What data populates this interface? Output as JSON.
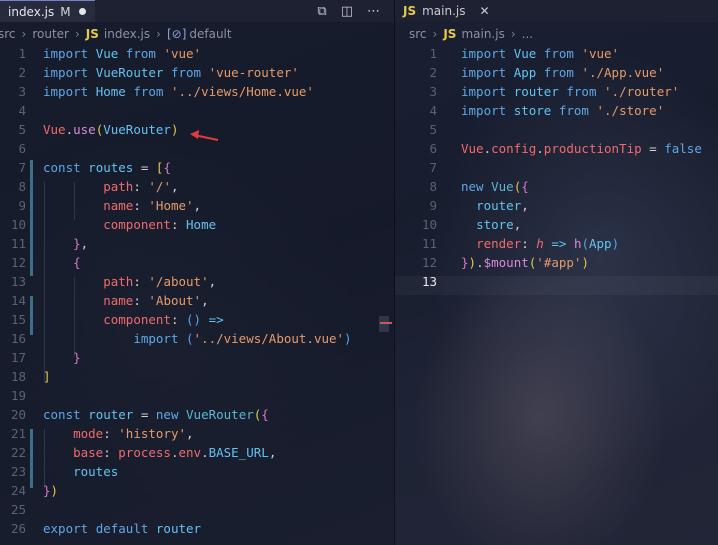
{
  "left": {
    "tab": {
      "label": "index.js",
      "modified": "M"
    },
    "breadcrumb": [
      "src",
      "router",
      "index.js",
      "default"
    ],
    "actions": [
      "compare-icon",
      "split-editor-icon",
      "more-icon"
    ],
    "lines": [
      {
        "n": "1",
        "tokens": [
          [
            "kw",
            "import"
          ],
          [
            "op",
            " "
          ],
          [
            "id",
            "Vue"
          ],
          [
            "op",
            " "
          ],
          [
            "kw",
            "from"
          ],
          [
            "op",
            " "
          ],
          [
            "str",
            "'vue'"
          ]
        ]
      },
      {
        "n": "2",
        "tokens": [
          [
            "kw",
            "import"
          ],
          [
            "op",
            " "
          ],
          [
            "id",
            "VueRouter"
          ],
          [
            "op",
            " "
          ],
          [
            "kw",
            "from"
          ],
          [
            "op",
            " "
          ],
          [
            "str",
            "'vue-router'"
          ]
        ]
      },
      {
        "n": "3",
        "tokens": [
          [
            "kw",
            "import"
          ],
          [
            "op",
            " "
          ],
          [
            "id",
            "Home"
          ],
          [
            "op",
            " "
          ],
          [
            "kw",
            "from"
          ],
          [
            "op",
            " "
          ],
          [
            "str",
            "'../views/Home.vue'"
          ]
        ]
      },
      {
        "n": "4",
        "tokens": []
      },
      {
        "n": "5",
        "tokens": [
          [
            "prop",
            "Vue"
          ],
          [
            "op",
            "."
          ],
          [
            "func",
            "use"
          ],
          [
            "br1",
            "("
          ],
          [
            "id",
            "VueRouter"
          ],
          [
            "br1",
            ")"
          ]
        ]
      },
      {
        "n": "6",
        "tokens": []
      },
      {
        "n": "7",
        "tokens": [
          [
            "kw",
            "const"
          ],
          [
            "op",
            " "
          ],
          [
            "id",
            "routes"
          ],
          [
            "op",
            " = "
          ],
          [
            "br1",
            "["
          ],
          [
            "br2",
            "{"
          ]
        ]
      },
      {
        "n": "8",
        "tokens": [
          [
            "op",
            "        "
          ],
          [
            "prop",
            "path"
          ],
          [
            "op",
            ": "
          ],
          [
            "str",
            "'/'"
          ],
          [
            "op",
            ","
          ]
        ]
      },
      {
        "n": "9",
        "tokens": [
          [
            "op",
            "        "
          ],
          [
            "prop",
            "name"
          ],
          [
            "op",
            ": "
          ],
          [
            "str",
            "'Home'"
          ],
          [
            "op",
            ","
          ]
        ]
      },
      {
        "n": "10",
        "tokens": [
          [
            "op",
            "        "
          ],
          [
            "prop",
            "component"
          ],
          [
            "op",
            ": "
          ],
          [
            "id",
            "Home"
          ]
        ]
      },
      {
        "n": "11",
        "tokens": [
          [
            "op",
            "    "
          ],
          [
            "br2",
            "}"
          ],
          [
            "op",
            ","
          ]
        ]
      },
      {
        "n": "12",
        "tokens": [
          [
            "op",
            "    "
          ],
          [
            "br2",
            "{"
          ]
        ]
      },
      {
        "n": "13",
        "tokens": [
          [
            "op",
            "        "
          ],
          [
            "prop",
            "path"
          ],
          [
            "op",
            ": "
          ],
          [
            "str",
            "'/about'"
          ],
          [
            "op",
            ","
          ]
        ]
      },
      {
        "n": "14",
        "tokens": [
          [
            "op",
            "        "
          ],
          [
            "prop",
            "name"
          ],
          [
            "op",
            ": "
          ],
          [
            "str",
            "'About'"
          ],
          [
            "op",
            ","
          ]
        ]
      },
      {
        "n": "15",
        "tokens": [
          [
            "op",
            "        "
          ],
          [
            "prop",
            "component"
          ],
          [
            "op",
            ": "
          ],
          [
            "br3",
            "()"
          ],
          [
            "op",
            " "
          ],
          [
            "arrowfn",
            "=>"
          ]
        ]
      },
      {
        "n": "16",
        "tokens": [
          [
            "op",
            "            "
          ],
          [
            "kw",
            "import"
          ],
          [
            "op",
            " "
          ],
          [
            "br3",
            "("
          ],
          [
            "str",
            "'../views/About.vue'"
          ],
          [
            "br3",
            ")"
          ]
        ]
      },
      {
        "n": "17",
        "tokens": [
          [
            "op",
            "    "
          ],
          [
            "br2",
            "}"
          ]
        ]
      },
      {
        "n": "18",
        "tokens": [
          [
            "br1",
            "]"
          ]
        ]
      },
      {
        "n": "19",
        "tokens": []
      },
      {
        "n": "20",
        "tokens": [
          [
            "kw",
            "const"
          ],
          [
            "op",
            " "
          ],
          [
            "id",
            "router"
          ],
          [
            "op",
            " = "
          ],
          [
            "kw",
            "new"
          ],
          [
            "op",
            " "
          ],
          [
            "cls",
            "VueRouter"
          ],
          [
            "br1",
            "("
          ],
          [
            "br2",
            "{"
          ]
        ]
      },
      {
        "n": "21",
        "tokens": [
          [
            "op",
            "    "
          ],
          [
            "prop",
            "mode"
          ],
          [
            "op",
            ": "
          ],
          [
            "str",
            "'history'"
          ],
          [
            "op",
            ","
          ]
        ]
      },
      {
        "n": "22",
        "tokens": [
          [
            "op",
            "    "
          ],
          [
            "prop",
            "base"
          ],
          [
            "op",
            ": "
          ],
          [
            "prop",
            "process"
          ],
          [
            "op",
            "."
          ],
          [
            "prop",
            "env"
          ],
          [
            "op",
            "."
          ],
          [
            "id",
            "BASE_URL"
          ],
          [
            "op",
            ","
          ]
        ]
      },
      {
        "n": "23",
        "tokens": [
          [
            "op",
            "    "
          ],
          [
            "id",
            "routes"
          ]
        ]
      },
      {
        "n": "24",
        "tokens": [
          [
            "br2",
            "}"
          ],
          [
            "br1",
            ")"
          ]
        ]
      },
      {
        "n": "25",
        "tokens": []
      },
      {
        "n": "26",
        "tokens": [
          [
            "kw",
            "export"
          ],
          [
            "op",
            " "
          ],
          [
            "kw",
            "default"
          ],
          [
            "op",
            " "
          ],
          [
            "id",
            "router"
          ]
        ]
      }
    ]
  },
  "right": {
    "tab": {
      "label": "main.js",
      "close": "✕"
    },
    "breadcrumb": [
      "src",
      "main.js",
      "..."
    ],
    "current_line": "13",
    "lines": [
      {
        "n": "1",
        "tokens": [
          [
            "kw",
            "import"
          ],
          [
            "op",
            " "
          ],
          [
            "id",
            "Vue"
          ],
          [
            "op",
            " "
          ],
          [
            "kw",
            "from"
          ],
          [
            "op",
            " "
          ],
          [
            "str",
            "'vue'"
          ]
        ]
      },
      {
        "n": "2",
        "tokens": [
          [
            "kw",
            "import"
          ],
          [
            "op",
            " "
          ],
          [
            "id",
            "App"
          ],
          [
            "op",
            " "
          ],
          [
            "kw",
            "from"
          ],
          [
            "op",
            " "
          ],
          [
            "str",
            "'./App.vue'"
          ]
        ]
      },
      {
        "n": "3",
        "tokens": [
          [
            "kw",
            "import"
          ],
          [
            "op",
            " "
          ],
          [
            "id",
            "router"
          ],
          [
            "op",
            " "
          ],
          [
            "kw",
            "from"
          ],
          [
            "op",
            " "
          ],
          [
            "str",
            "'./router'"
          ]
        ]
      },
      {
        "n": "4",
        "tokens": [
          [
            "kw",
            "import"
          ],
          [
            "op",
            " "
          ],
          [
            "id",
            "store"
          ],
          [
            "op",
            " "
          ],
          [
            "kw",
            "from"
          ],
          [
            "op",
            " "
          ],
          [
            "str",
            "'./store'"
          ]
        ]
      },
      {
        "n": "5",
        "tokens": []
      },
      {
        "n": "6",
        "tokens": [
          [
            "prop",
            "Vue"
          ],
          [
            "op",
            "."
          ],
          [
            "prop",
            "config"
          ],
          [
            "op",
            "."
          ],
          [
            "prop",
            "productionTip"
          ],
          [
            "op",
            " = "
          ],
          [
            "kw",
            "false"
          ]
        ]
      },
      {
        "n": "7",
        "tokens": []
      },
      {
        "n": "8",
        "tokens": [
          [
            "kw",
            "new"
          ],
          [
            "op",
            " "
          ],
          [
            "cls",
            "Vue"
          ],
          [
            "br1",
            "("
          ],
          [
            "br2",
            "{"
          ]
        ]
      },
      {
        "n": "9",
        "tokens": [
          [
            "op",
            "  "
          ],
          [
            "id",
            "router"
          ],
          [
            "op",
            ","
          ]
        ]
      },
      {
        "n": "10",
        "tokens": [
          [
            "op",
            "  "
          ],
          [
            "id",
            "store"
          ],
          [
            "op",
            ","
          ]
        ]
      },
      {
        "n": "11",
        "tokens": [
          [
            "op",
            "  "
          ],
          [
            "prop",
            "render"
          ],
          [
            "op",
            ": "
          ],
          [
            "param",
            "h"
          ],
          [
            "op",
            " "
          ],
          [
            "arrowfn",
            "=>"
          ],
          [
            "op",
            " "
          ],
          [
            "func",
            "h"
          ],
          [
            "br3",
            "("
          ],
          [
            "id",
            "App"
          ],
          [
            "br3",
            ")"
          ]
        ]
      },
      {
        "n": "12",
        "tokens": [
          [
            "br2",
            "}"
          ],
          [
            "br1",
            ")"
          ],
          [
            "op",
            "."
          ],
          [
            "func",
            "$mount"
          ],
          [
            "br1",
            "("
          ],
          [
            "str",
            "'#app'"
          ],
          [
            "br1",
            ")"
          ]
        ]
      },
      {
        "n": "13",
        "tokens": []
      }
    ]
  }
}
